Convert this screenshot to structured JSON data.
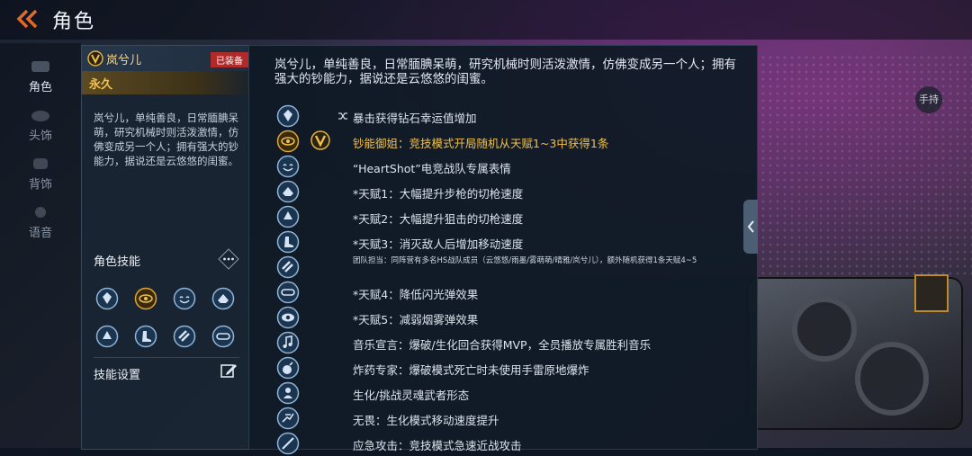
{
  "header": {
    "title": "角色"
  },
  "nav": [
    {
      "label": "角色",
      "active": true
    },
    {
      "label": "头饰",
      "active": false
    },
    {
      "label": "背饰",
      "active": false
    },
    {
      "label": "语音",
      "active": false
    }
  ],
  "card": {
    "name": "岚兮儿",
    "equipped": "已装备",
    "duration": "永久",
    "description": "岚兮儿，单纯善良，日常腼腆呆萌，研究机械时则活泼激情，仿佛变成另一个人；拥有强大的钞能力，据说还是云悠悠的闺蜜。",
    "skills_title": "角色技能",
    "settings_label": "技能设置"
  },
  "panel": {
    "intro": "岚兮儿，单纯善良，日常腼腆呆萌，研究机械时则活泼激情，仿佛变成另一个人；拥有强大的钞能力，据说还是云悠悠的闺蜜。",
    "attributes": [
      {
        "icon": "diamond-luck-icon",
        "text": "暴击获得钻石幸运值增加"
      },
      {
        "icon": "money-eye-icon",
        "text": "钞能御姐：竞技模式开局随机从天赋1~3中获得1条"
      },
      {
        "icon": "smile-emote-icon",
        "text": "“HeartShot”电竞战队专属表情"
      },
      {
        "icon": "rifle-talent-icon",
        "text": "*天赋1：大幅提升步枪的切枪速度"
      },
      {
        "icon": "sniper-talent-icon",
        "text": "*天赋2：大幅提升狙击的切枪速度"
      },
      {
        "icon": "boot-speed-icon",
        "text": "*天赋3：消灭敌人后增加移动速度"
      },
      {
        "icon": "team-stripe-icon",
        "text": "团队担当：同阵营有多名HS战队成员（云悠悠/雨墨/雾萌萌/晴雅/岚兮儿），额外随机获得1条天赋4~5"
      },
      {
        "icon": "flash-goggles-icon",
        "text": "*天赋4：降低闪光弹效果"
      },
      {
        "icon": "smoke-eye-icon",
        "text": "*天赋5：减弱烟雾弹效果"
      },
      {
        "icon": "music-note-icon",
        "text": "音乐宣言：爆破/生化回合获得MVP，全员播放专属胜利音乐"
      },
      {
        "icon": "bomb-expert-icon",
        "text": "炸药专家：爆破模式死亡时未使用手雷原地爆炸"
      },
      {
        "icon": "spirit-warrior-icon",
        "text": "生化/挑战灵魂武者形态"
      },
      {
        "icon": "fearless-run-icon",
        "text": "无畏：生化模式移动速度提升"
      },
      {
        "icon": "melee-attack-icon",
        "text": "应急攻击：竞技模式急速近战攻击"
      }
    ]
  },
  "side": {
    "hand_label": "手持"
  },
  "colors": {
    "gold": "#f2c04c",
    "equipped_red": "#b02a2a",
    "panel_bg": "#0f1925"
  }
}
